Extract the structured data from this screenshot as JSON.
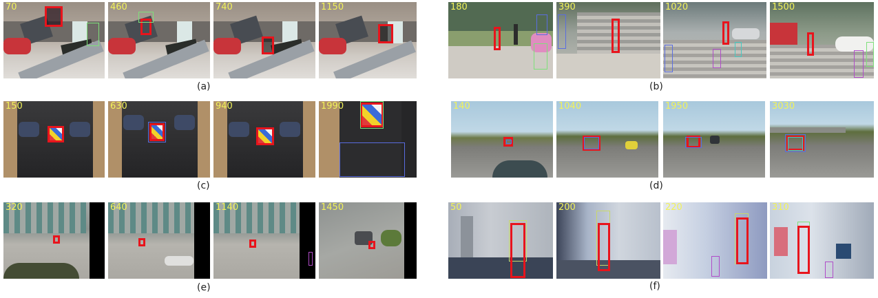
{
  "panels": [
    {
      "caption": "(a)",
      "frames": [
        "70",
        "460",
        "740",
        "1150"
      ]
    },
    {
      "caption": "(b)",
      "frames": [
        "180",
        "390",
        "1020",
        "1500"
      ]
    },
    {
      "caption": "(c)",
      "frames": [
        "150",
        "630",
        "940",
        "1990"
      ]
    },
    {
      "caption": "(d)",
      "frames": [
        "140",
        "1040",
        "1950",
        "3030"
      ]
    },
    {
      "caption": "(e)",
      "frames": [
        "320",
        "640",
        "1140",
        "1450"
      ]
    },
    {
      "caption": "(f)",
      "frames": [
        "50",
        "200",
        "220",
        "310"
      ]
    }
  ],
  "colors": {
    "tracker_box": "#e8141c",
    "frame_number": "#f2f25a",
    "other_boxes": [
      "#7ee07a",
      "#5a6de0",
      "#b04cc8",
      "#c9d86a",
      "#46c8c0"
    ]
  }
}
